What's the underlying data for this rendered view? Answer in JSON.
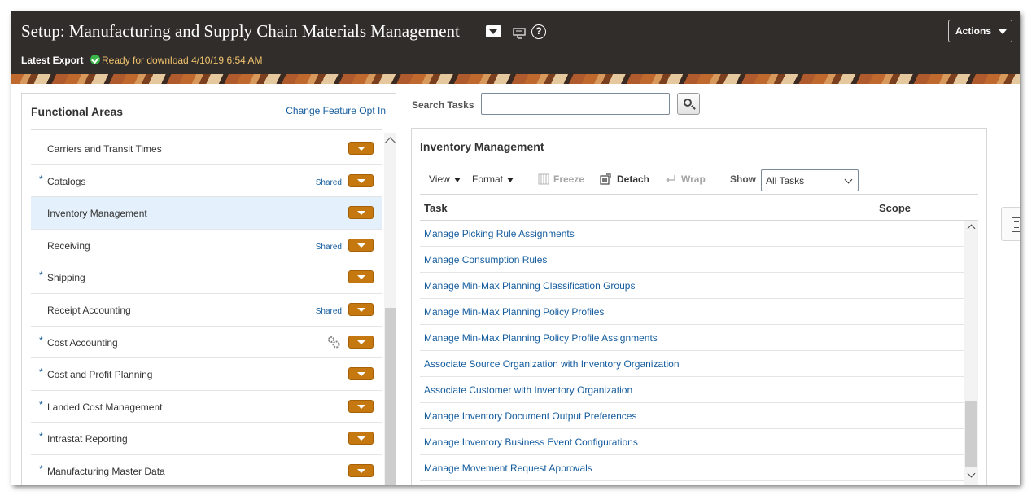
{
  "header": {
    "title": "Setup: Manufacturing and Supply Chain Materials Management",
    "actions_label": "Actions",
    "export_label": "Latest Export",
    "export_status": "Ready for download 4/10/19 6:54 AM"
  },
  "functional_areas": {
    "title": "Functional Areas",
    "change_link": "Change Feature Opt In",
    "items": [
      {
        "label": "Carriers and Transit Times",
        "required": false,
        "shared": "",
        "selected": false,
        "gear": false
      },
      {
        "label": "Catalogs",
        "required": true,
        "shared": "Shared",
        "selected": false,
        "gear": false
      },
      {
        "label": "Inventory Management",
        "required": false,
        "shared": "",
        "selected": true,
        "gear": false
      },
      {
        "label": "Receiving",
        "required": false,
        "shared": "Shared",
        "selected": false,
        "gear": false
      },
      {
        "label": "Shipping",
        "required": true,
        "shared": "",
        "selected": false,
        "gear": false
      },
      {
        "label": "Receipt Accounting",
        "required": false,
        "shared": "Shared",
        "selected": false,
        "gear": false
      },
      {
        "label": "Cost Accounting",
        "required": true,
        "shared": "",
        "selected": false,
        "gear": true
      },
      {
        "label": "Cost and Profit Planning",
        "required": true,
        "shared": "",
        "selected": false,
        "gear": false
      },
      {
        "label": "Landed Cost Management",
        "required": true,
        "shared": "",
        "selected": false,
        "gear": false
      },
      {
        "label": "Intrastat Reporting",
        "required": true,
        "shared": "",
        "selected": false,
        "gear": false
      },
      {
        "label": "Manufacturing Master Data",
        "required": true,
        "shared": "",
        "selected": false,
        "gear": false
      }
    ]
  },
  "search": {
    "label": "Search Tasks",
    "value": ""
  },
  "task_panel": {
    "title": "Inventory Management",
    "toolbar": {
      "view": "View",
      "format": "Format",
      "freeze": "Freeze",
      "detach": "Detach",
      "wrap": "Wrap",
      "show_label": "Show",
      "show_value": "All Tasks"
    },
    "columns": {
      "task": "Task",
      "scope": "Scope"
    },
    "tasks": [
      "Manage Picking Rule Assignments",
      "Manage Consumption Rules",
      "Manage Min-Max Planning Classification Groups",
      "Manage Min-Max Planning Policy Profiles",
      "Manage Min-Max Planning Policy Profile Assignments",
      "Associate Source Organization with Inventory Organization",
      "Associate Customer with Inventory Organization",
      "Manage Inventory Document Output Preferences",
      "Manage Inventory Business Event Configurations",
      "Manage Movement Request Approvals"
    ]
  },
  "icons": {
    "title_dropdown": "chevron-down-icon",
    "favorites": "favorites-icon",
    "help": "help-icon",
    "export_status": "check-icon",
    "search": "search-icon",
    "freeze": "freeze-icon",
    "detach": "detach-icon",
    "wrap": "wrap-icon",
    "gear": "gear-icon",
    "side_tab": "tasks-panel-icon"
  },
  "colors": {
    "header_bg": "#312d2a",
    "link": "#145c9e",
    "dropdown_button": "#c5780f",
    "selected_row": "#e4f0fb",
    "status_text": "#f0c26e",
    "status_check": "#3ab54a"
  }
}
